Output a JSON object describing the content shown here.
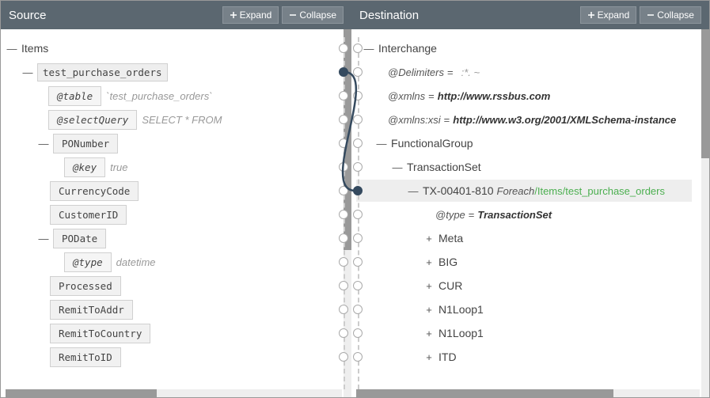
{
  "source": {
    "title": "Source",
    "expand": "Expand",
    "collapse": "Collapse",
    "tree": {
      "root": "Items",
      "table_node": "test_purchase_orders",
      "attr_table": {
        "key": "@table",
        "val": "`test_purchase_orders`"
      },
      "attr_selectQuery": {
        "key": "@selectQuery",
        "val": "SELECT * FROM"
      },
      "ponumber": "PONumber",
      "attr_key": {
        "key": "@key",
        "val": "true"
      },
      "currency": "CurrencyCode",
      "customerid": "CustomerID",
      "podate": "PODate",
      "attr_type": {
        "key": "@type",
        "val": "datetime"
      },
      "processed": "Processed",
      "remittoaddr": "RemitToAddr",
      "remittocountry": "RemitToCountry",
      "remittoid": "RemitToID"
    }
  },
  "dest": {
    "title": "Destination",
    "expand": "Expand",
    "collapse": "Collapse",
    "tree": {
      "root": "Interchange",
      "delim": {
        "key": "@Delimiters",
        "val": ":*. ~"
      },
      "xmlns": {
        "key": "@xmlns",
        "val": "http://www.rssbus.com"
      },
      "xsi": {
        "key": "@xmlns:xsi",
        "val": "http://www.w3.org/2001/XMLSchema-instance"
      },
      "fg": "FunctionalGroup",
      "ts": "TransactionSet",
      "tx": {
        "label": "TX-00401-810",
        "foreach": "Foreach",
        "path": "/Items/test_purchase_orders"
      },
      "attr_type": {
        "key": "@type",
        "val": "TransactionSet"
      },
      "meta": "Meta",
      "big": "BIG",
      "cur": "CUR",
      "n1a": "N1Loop1",
      "n1b": "N1Loop1",
      "itd": "ITD"
    }
  }
}
